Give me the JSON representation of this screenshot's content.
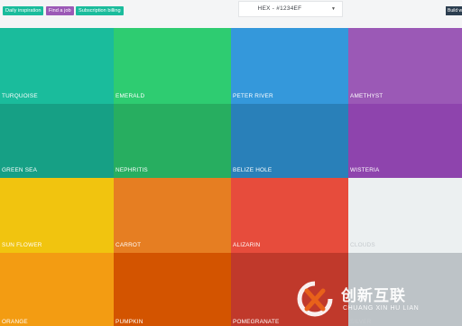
{
  "header": {
    "tags": [
      {
        "label": "Daily inspiration",
        "color": "#1abc9c"
      },
      {
        "label": "Find a job",
        "color": "#9b59b6"
      },
      {
        "label": "Subscription billing",
        "color": "#1abc9c"
      }
    ],
    "format_select": {
      "value": "HEX - #1234EF"
    },
    "build_button": {
      "label": "Build w"
    }
  },
  "colors": [
    {
      "name": "TURQUOISE",
      "hex": "#1abc9c"
    },
    {
      "name": "EMERALD",
      "hex": "#2ecc71"
    },
    {
      "name": "PETER RIVER",
      "hex": "#3498db"
    },
    {
      "name": "AMETHYST",
      "hex": "#9b59b6"
    },
    {
      "name": "GREEN SEA",
      "hex": "#16a085"
    },
    {
      "name": "NEPHRITIS",
      "hex": "#27ae60"
    },
    {
      "name": "BELIZE HOLE",
      "hex": "#2980b9"
    },
    {
      "name": "WISTERIA",
      "hex": "#8e44ad"
    },
    {
      "name": "SUN FLOWER",
      "hex": "#f1c40f"
    },
    {
      "name": "CARROT",
      "hex": "#e67e22"
    },
    {
      "name": "ALIZARIN",
      "hex": "#e74c3c"
    },
    {
      "name": "CLOUDS",
      "hex": "#ecf0f1"
    },
    {
      "name": "ORANGE",
      "hex": "#f39c12"
    },
    {
      "name": "PUMPKIN",
      "hex": "#d35400"
    },
    {
      "name": "POMEGRANATE",
      "hex": "#c0392b"
    },
    {
      "name": "SILVER",
      "hex": "#bdc3c7"
    }
  ],
  "watermark": {
    "chinese": "创新互联",
    "english": "CHUANG XIN HU LIAN",
    "brand_color": "#e8611a"
  }
}
